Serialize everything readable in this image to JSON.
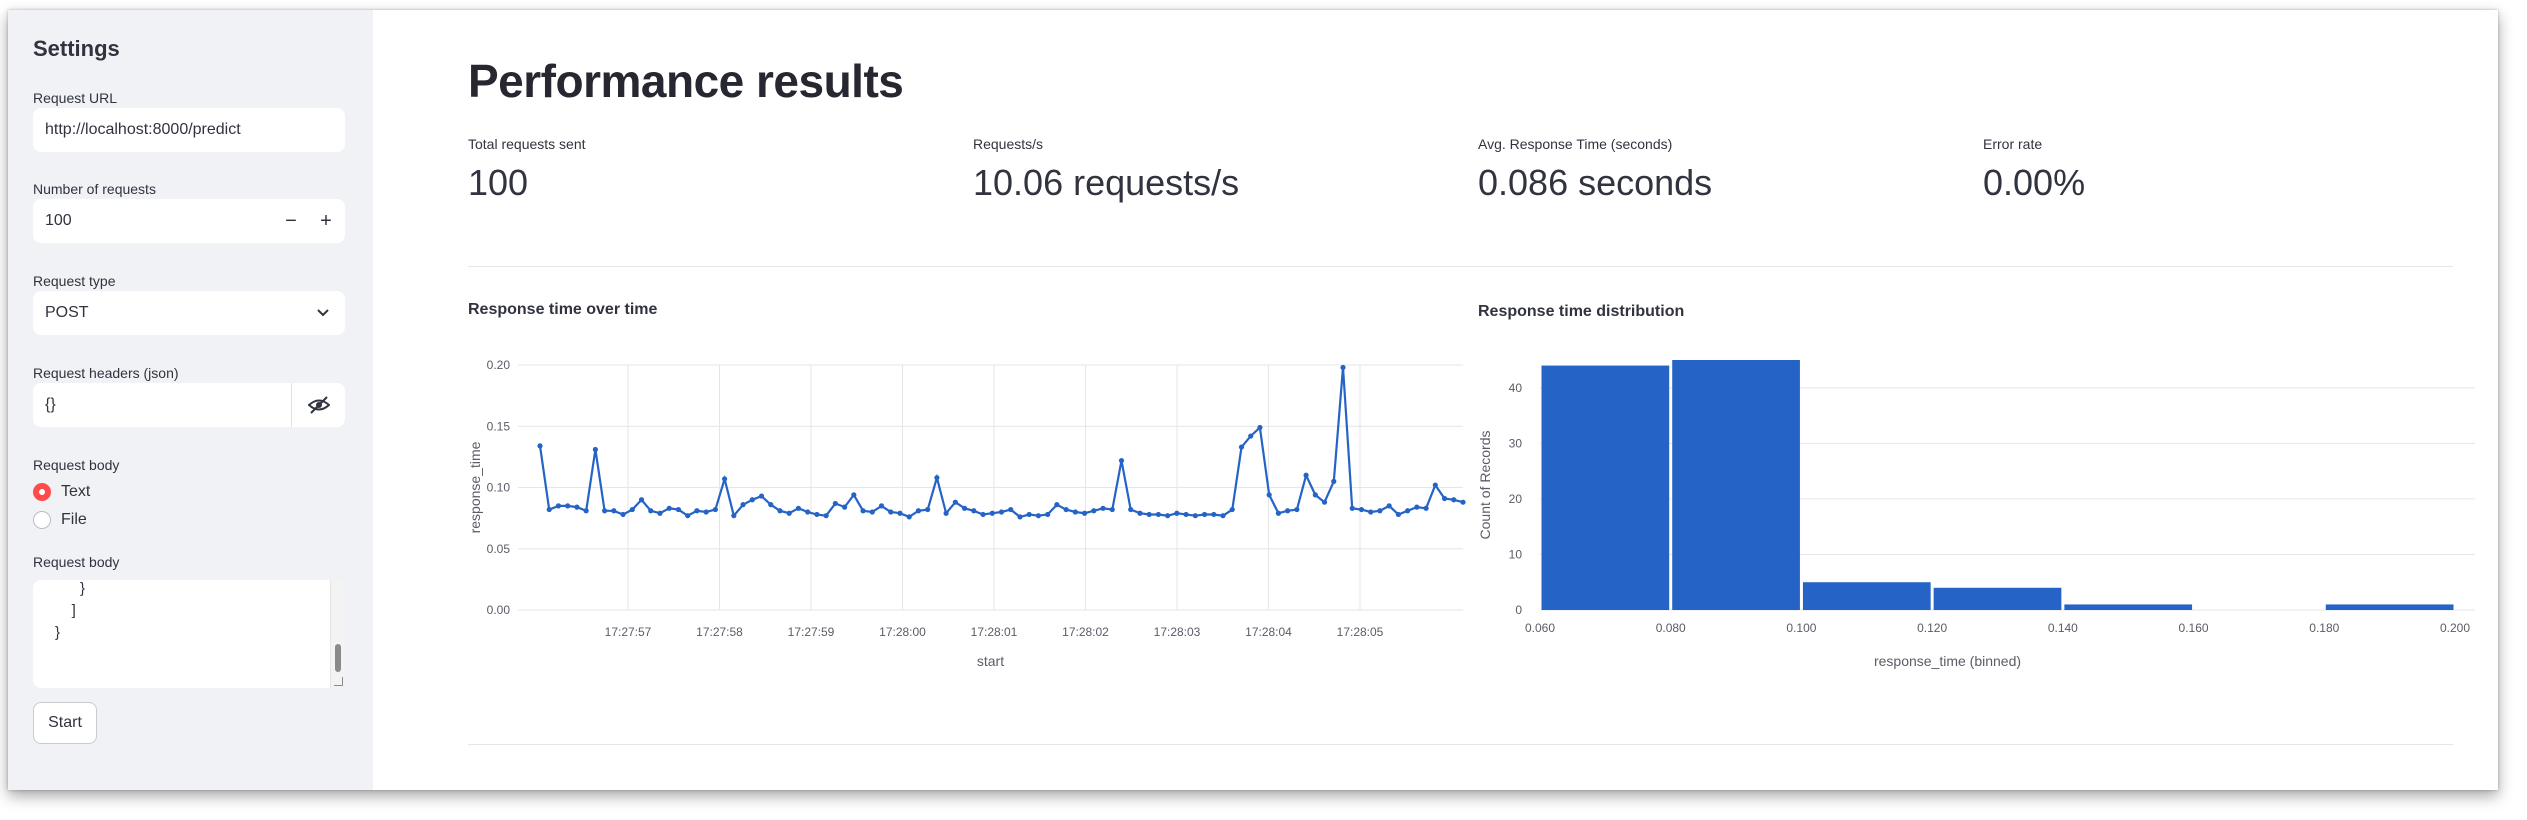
{
  "sidebar": {
    "title": "Settings",
    "url_label": "Request URL",
    "url_value": "http://localhost:8000/predict",
    "num_label": "Number of requests",
    "num_value": "100",
    "minus": "−",
    "plus": "+",
    "type_label": "Request type",
    "type_value": "POST",
    "headers_label": "Request headers (json)",
    "headers_value": "{}",
    "body_radio_label": "Request body",
    "radio_text": "Text",
    "radio_file": "File",
    "body_label": "Request body",
    "body_text": "      }\n    ]\n}",
    "start_label": "Start"
  },
  "main": {
    "title": "Performance results",
    "metrics": [
      {
        "label": "Total requests sent",
        "value": "100"
      },
      {
        "label": "Requests/s",
        "value": "10.06 requests/s"
      },
      {
        "label": "Avg. Response Time (seconds)",
        "value": "0.086 seconds"
      },
      {
        "label": "Error rate",
        "value": "0.00%"
      }
    ]
  },
  "chart_data": [
    {
      "type": "line",
      "title": "Response time over time",
      "xlabel": "start",
      "ylabel": "response_time",
      "x_tick_labels": [
        "17:27:57",
        "17:27:58",
        "17:27:59",
        "17:28:00",
        "17:28:01",
        "17:28:02",
        "17:28:03",
        "17:28:04",
        "17:28:05"
      ],
      "y_ticks": [
        "0.00",
        "0.05",
        "0.10",
        "0.15",
        "0.20"
      ],
      "ylim": [
        0,
        0.2
      ],
      "color": "#2563c7",
      "grid": true,
      "y": [
        0.134,
        0.082,
        0.085,
        0.085,
        0.084,
        0.081,
        0.131,
        0.081,
        0.081,
        0.078,
        0.082,
        0.09,
        0.081,
        0.079,
        0.083,
        0.082,
        0.077,
        0.081,
        0.08,
        0.082,
        0.107,
        0.077,
        0.086,
        0.09,
        0.093,
        0.086,
        0.081,
        0.079,
        0.083,
        0.08,
        0.078,
        0.077,
        0.087,
        0.084,
        0.094,
        0.081,
        0.08,
        0.085,
        0.08,
        0.079,
        0.076,
        0.081,
        0.082,
        0.108,
        0.079,
        0.088,
        0.083,
        0.081,
        0.078,
        0.079,
        0.08,
        0.082,
        0.076,
        0.078,
        0.077,
        0.078,
        0.086,
        0.082,
        0.08,
        0.079,
        0.081,
        0.083,
        0.082,
        0.122,
        0.082,
        0.079,
        0.078,
        0.078,
        0.077,
        0.079,
        0.078,
        0.077,
        0.078,
        0.078,
        0.077,
        0.082,
        0.133,
        0.142,
        0.149,
        0.094,
        0.079,
        0.081,
        0.082,
        0.11,
        0.094,
        0.088,
        0.105,
        0.198,
        0.083,
        0.082,
        0.08,
        0.081,
        0.085,
        0.078,
        0.081,
        0.084,
        0.083,
        0.102,
        0.091,
        0.09,
        0.088
      ]
    },
    {
      "type": "bar",
      "title": "Response time distribution",
      "xlabel": "response_time (binned)",
      "ylabel": "Count of Records",
      "bins": [
        [
          0.06,
          0.08
        ],
        [
          0.08,
          0.1
        ],
        [
          0.1,
          0.12
        ],
        [
          0.12,
          0.14
        ],
        [
          0.14,
          0.16
        ],
        [
          0.16,
          0.18
        ],
        [
          0.18,
          0.2
        ]
      ],
      "values": [
        44,
        45,
        5,
        4,
        1,
        0,
        1
      ],
      "x_tick_labels": [
        "0.060",
        "0.080",
        "0.100",
        "0.120",
        "0.140",
        "0.160",
        "0.180",
        "0.200"
      ],
      "y_ticks": [
        "0",
        "10",
        "20",
        "30",
        "40"
      ],
      "ylim": [
        0,
        45
      ],
      "color": "#2563c7",
      "grid": true
    }
  ]
}
